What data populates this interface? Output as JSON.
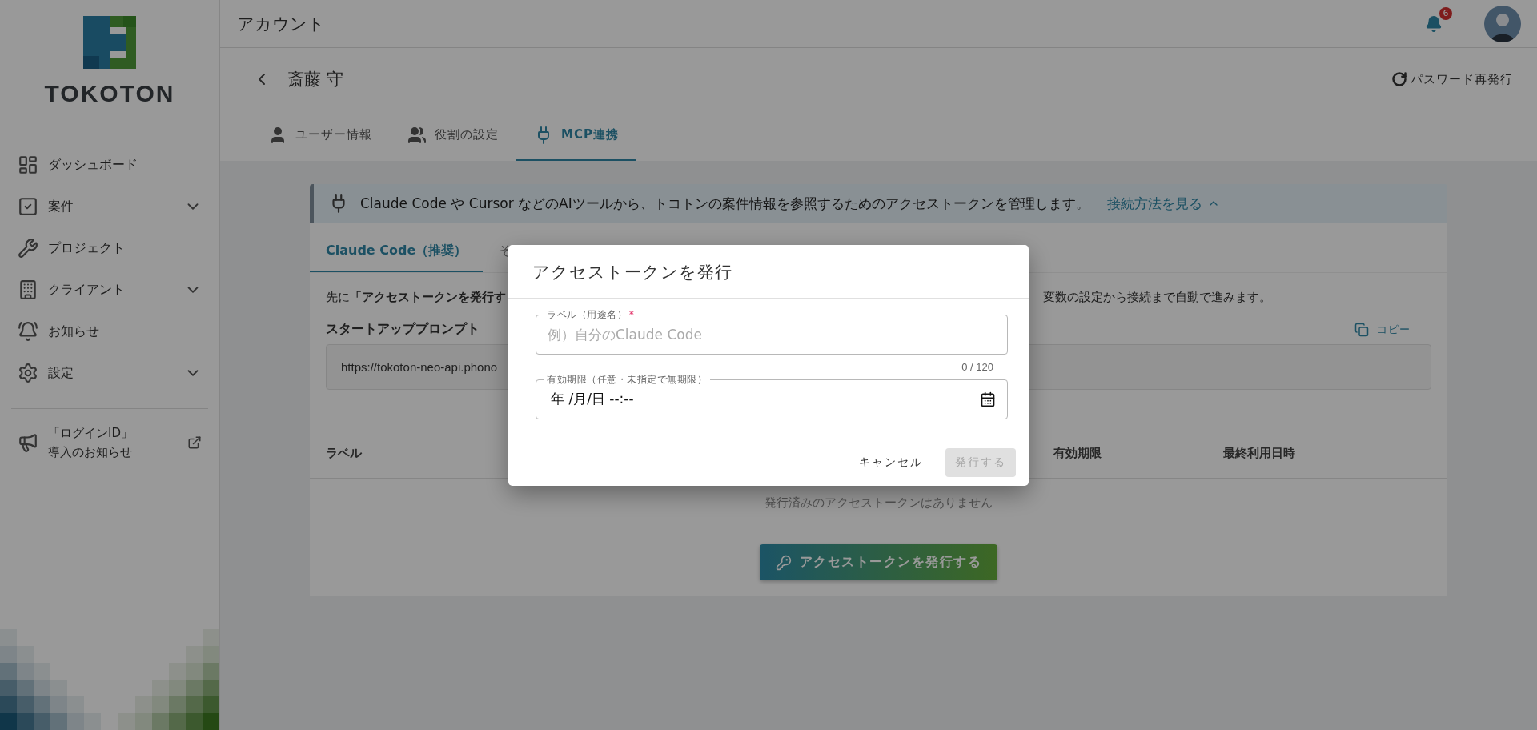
{
  "sidebar": {
    "brand": "TOKOTON",
    "items": [
      {
        "label": "ダッシュボード",
        "expandable": false
      },
      {
        "label": "案件",
        "expandable": true
      },
      {
        "label": "プロジェクト",
        "expandable": false
      },
      {
        "label": "クライアント",
        "expandable": true
      },
      {
        "label": "お知らせ",
        "expandable": false
      },
      {
        "label": "設定",
        "expandable": true
      }
    ],
    "notice": {
      "line1": "「ログインID」",
      "line2": "導入のお知らせ"
    }
  },
  "header": {
    "title": "アカウント",
    "notification_count": "6"
  },
  "user": {
    "name": "斎藤 守",
    "reset_password": "パスワード再発行"
  },
  "tabs": [
    {
      "label": "ユーザー情報",
      "selected": false
    },
    {
      "label": "役割の設定",
      "selected": false
    },
    {
      "label": "MCP連携",
      "selected": true
    }
  ],
  "banner": {
    "text": "Claude Code や Cursor などのAIツールから、トコトンの案件情報を参照するためのアクセストークンを管理します。",
    "link": "接続方法を見る",
    "expanded": true
  },
  "sub_tabs": [
    {
      "label": "Claude Code（推奨）",
      "selected": true
    },
    {
      "label": "そ",
      "selected": false
    }
  ],
  "instructions": {
    "left": "先に**「アクセストークンを発行す**",
    "right": "変数の設定から接続まで自動で進みます。"
  },
  "prompt": {
    "title": "スタートアッププロンプト",
    "copy": "コピー",
    "text": "https://tokoton-neo-api.phono"
  },
  "table": {
    "columns": [
      {
        "label": "ラベル"
      },
      {
        "label": "有効期限"
      },
      {
        "label": "最終利用日時"
      }
    ],
    "empty": "発行済みのアクセストークンはありません"
  },
  "issue_button": "アクセストークンを発行する",
  "dialog": {
    "title": "アクセストークンを発行",
    "label_field": {
      "label": "ラベル（用途名）",
      "required_mark": "*",
      "placeholder": "例）自分のClaude Code",
      "counter": "0 / 120"
    },
    "expiry_field": {
      "label": "有効期限（任意・未指定で無期限）",
      "value": "年 /月/日 --:--"
    },
    "cancel": "キャンセル",
    "submit": {
      "label": "発行する",
      "disabled": true
    }
  }
}
